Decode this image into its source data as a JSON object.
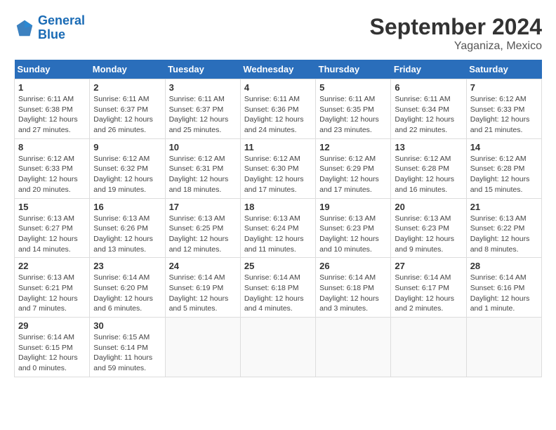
{
  "logo": {
    "line1": "General",
    "line2": "Blue"
  },
  "title": "September 2024",
  "location": "Yaganiza, Mexico",
  "days_of_week": [
    "Sunday",
    "Monday",
    "Tuesday",
    "Wednesday",
    "Thursday",
    "Friday",
    "Saturday"
  ],
  "weeks": [
    [
      {
        "day": "1",
        "detail": "Sunrise: 6:11 AM\nSunset: 6:38 PM\nDaylight: 12 hours\nand 27 minutes."
      },
      {
        "day": "2",
        "detail": "Sunrise: 6:11 AM\nSunset: 6:37 PM\nDaylight: 12 hours\nand 26 minutes."
      },
      {
        "day": "3",
        "detail": "Sunrise: 6:11 AM\nSunset: 6:37 PM\nDaylight: 12 hours\nand 25 minutes."
      },
      {
        "day": "4",
        "detail": "Sunrise: 6:11 AM\nSunset: 6:36 PM\nDaylight: 12 hours\nand 24 minutes."
      },
      {
        "day": "5",
        "detail": "Sunrise: 6:11 AM\nSunset: 6:35 PM\nDaylight: 12 hours\nand 23 minutes."
      },
      {
        "day": "6",
        "detail": "Sunrise: 6:11 AM\nSunset: 6:34 PM\nDaylight: 12 hours\nand 22 minutes."
      },
      {
        "day": "7",
        "detail": "Sunrise: 6:12 AM\nSunset: 6:33 PM\nDaylight: 12 hours\nand 21 minutes."
      }
    ],
    [
      {
        "day": "8",
        "detail": "Sunrise: 6:12 AM\nSunset: 6:33 PM\nDaylight: 12 hours\nand 20 minutes."
      },
      {
        "day": "9",
        "detail": "Sunrise: 6:12 AM\nSunset: 6:32 PM\nDaylight: 12 hours\nand 19 minutes."
      },
      {
        "day": "10",
        "detail": "Sunrise: 6:12 AM\nSunset: 6:31 PM\nDaylight: 12 hours\nand 18 minutes."
      },
      {
        "day": "11",
        "detail": "Sunrise: 6:12 AM\nSunset: 6:30 PM\nDaylight: 12 hours\nand 17 minutes."
      },
      {
        "day": "12",
        "detail": "Sunrise: 6:12 AM\nSunset: 6:29 PM\nDaylight: 12 hours\nand 17 minutes."
      },
      {
        "day": "13",
        "detail": "Sunrise: 6:12 AM\nSunset: 6:28 PM\nDaylight: 12 hours\nand 16 minutes."
      },
      {
        "day": "14",
        "detail": "Sunrise: 6:12 AM\nSunset: 6:28 PM\nDaylight: 12 hours\nand 15 minutes."
      }
    ],
    [
      {
        "day": "15",
        "detail": "Sunrise: 6:13 AM\nSunset: 6:27 PM\nDaylight: 12 hours\nand 14 minutes."
      },
      {
        "day": "16",
        "detail": "Sunrise: 6:13 AM\nSunset: 6:26 PM\nDaylight: 12 hours\nand 13 minutes."
      },
      {
        "day": "17",
        "detail": "Sunrise: 6:13 AM\nSunset: 6:25 PM\nDaylight: 12 hours\nand 12 minutes."
      },
      {
        "day": "18",
        "detail": "Sunrise: 6:13 AM\nSunset: 6:24 PM\nDaylight: 12 hours\nand 11 minutes."
      },
      {
        "day": "19",
        "detail": "Sunrise: 6:13 AM\nSunset: 6:23 PM\nDaylight: 12 hours\nand 10 minutes."
      },
      {
        "day": "20",
        "detail": "Sunrise: 6:13 AM\nSunset: 6:23 PM\nDaylight: 12 hours\nand 9 minutes."
      },
      {
        "day": "21",
        "detail": "Sunrise: 6:13 AM\nSunset: 6:22 PM\nDaylight: 12 hours\nand 8 minutes."
      }
    ],
    [
      {
        "day": "22",
        "detail": "Sunrise: 6:13 AM\nSunset: 6:21 PM\nDaylight: 12 hours\nand 7 minutes."
      },
      {
        "day": "23",
        "detail": "Sunrise: 6:14 AM\nSunset: 6:20 PM\nDaylight: 12 hours\nand 6 minutes."
      },
      {
        "day": "24",
        "detail": "Sunrise: 6:14 AM\nSunset: 6:19 PM\nDaylight: 12 hours\nand 5 minutes."
      },
      {
        "day": "25",
        "detail": "Sunrise: 6:14 AM\nSunset: 6:18 PM\nDaylight: 12 hours\nand 4 minutes."
      },
      {
        "day": "26",
        "detail": "Sunrise: 6:14 AM\nSunset: 6:18 PM\nDaylight: 12 hours\nand 3 minutes."
      },
      {
        "day": "27",
        "detail": "Sunrise: 6:14 AM\nSunset: 6:17 PM\nDaylight: 12 hours\nand 2 minutes."
      },
      {
        "day": "28",
        "detail": "Sunrise: 6:14 AM\nSunset: 6:16 PM\nDaylight: 12 hours\nand 1 minute."
      }
    ],
    [
      {
        "day": "29",
        "detail": "Sunrise: 6:14 AM\nSunset: 6:15 PM\nDaylight: 12 hours\nand 0 minutes."
      },
      {
        "day": "30",
        "detail": "Sunrise: 6:15 AM\nSunset: 6:14 PM\nDaylight: 11 hours\nand 59 minutes."
      },
      {
        "day": "",
        "detail": ""
      },
      {
        "day": "",
        "detail": ""
      },
      {
        "day": "",
        "detail": ""
      },
      {
        "day": "",
        "detail": ""
      },
      {
        "day": "",
        "detail": ""
      }
    ]
  ]
}
